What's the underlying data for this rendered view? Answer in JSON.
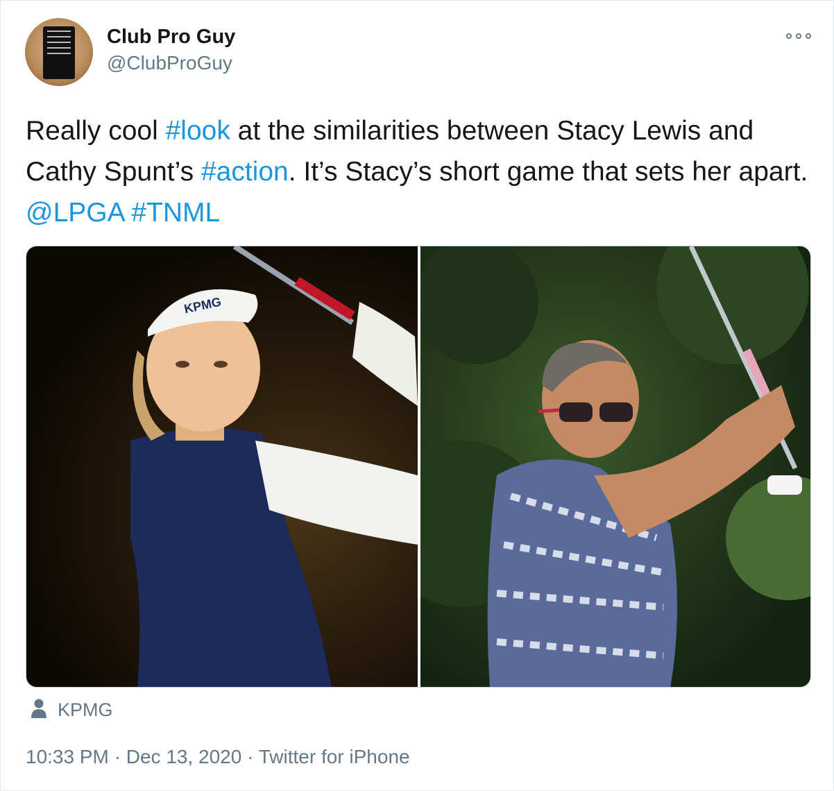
{
  "tweet": {
    "display_name": "Club Pro Guy",
    "handle": "@ClubProGuy",
    "text_parts": [
      {
        "text": "Really cool ",
        "type": "text"
      },
      {
        "text": "#look",
        "type": "link"
      },
      {
        "text": " at the similarities between Stacy Lewis and Cathy Spunt’s ",
        "type": "text"
      },
      {
        "text": "#action",
        "type": "link"
      },
      {
        "text": ". It’s Stacy’s short game that sets her apart. ",
        "type": "text"
      },
      {
        "text": "@LPGA",
        "type": "link"
      },
      {
        "text": " ",
        "type": "text"
      },
      {
        "text": "#TNML",
        "type": "link"
      }
    ],
    "tagged_user": "KPMG",
    "time": "10:33 PM",
    "date": "Dec 13, 2020",
    "source": "Twitter for iPhone",
    "separator": "·"
  },
  "media": {
    "images": [
      {
        "label": "photo-stacy-lewis"
      },
      {
        "label": "photo-cathy-spunt"
      }
    ]
  },
  "icons": {
    "more": "more-options-icon",
    "user": "person-icon"
  },
  "colors": {
    "link": "#1b95e0",
    "text": "#14171a",
    "secondary": "#657786",
    "border": "#ccd6dd"
  }
}
